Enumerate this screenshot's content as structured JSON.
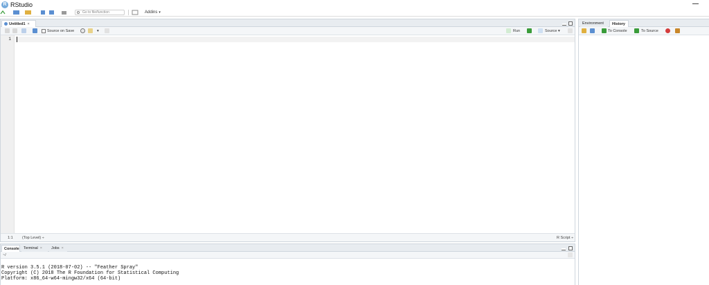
{
  "window": {
    "title": "RStudio",
    "logo_letter": "R"
  },
  "toolbar": {
    "goto_placeholder": "Go to file/function",
    "addins_label": "Addins",
    "addins_caret": "▾"
  },
  "source_pane": {
    "tab_label": "Untitled1",
    "tab_close": "×",
    "source_on_save_label": "Source on Save",
    "run_label": "Run",
    "source_label": "Source",
    "source_caret": "▾",
    "line_numbers": [
      "1"
    ],
    "status": {
      "position": "1:1",
      "scope": "(Top Level)",
      "scope_caret": "÷",
      "file_type": "R Script",
      "file_type_caret": "÷"
    }
  },
  "console_pane": {
    "tabs": [
      {
        "label": "Console",
        "close": ""
      },
      {
        "label": "Terminal",
        "close": "×"
      },
      {
        "label": "Jobs",
        "close": "×"
      }
    ],
    "path": "~/",
    "lines": [
      "R version 3.5.1 (2018-07-02) -- \"Feather Spray\"",
      "Copyright (C) 2018 The R Foundation for Statistical Computing",
      "Platform: x86_64-w64-mingw32/x64 (64-bit)"
    ]
  },
  "env_pane": {
    "tabs": [
      {
        "label": "Environment"
      },
      {
        "label": "History"
      }
    ],
    "to_console_label": "To Console",
    "to_source_label": "To Source"
  },
  "colors": {
    "accent": "#75aadb",
    "pane_header": "#e8ecf0",
    "run_arrow": "#3a9c3a",
    "delete_red": "#d43c3c",
    "broom": "#c9872a"
  }
}
